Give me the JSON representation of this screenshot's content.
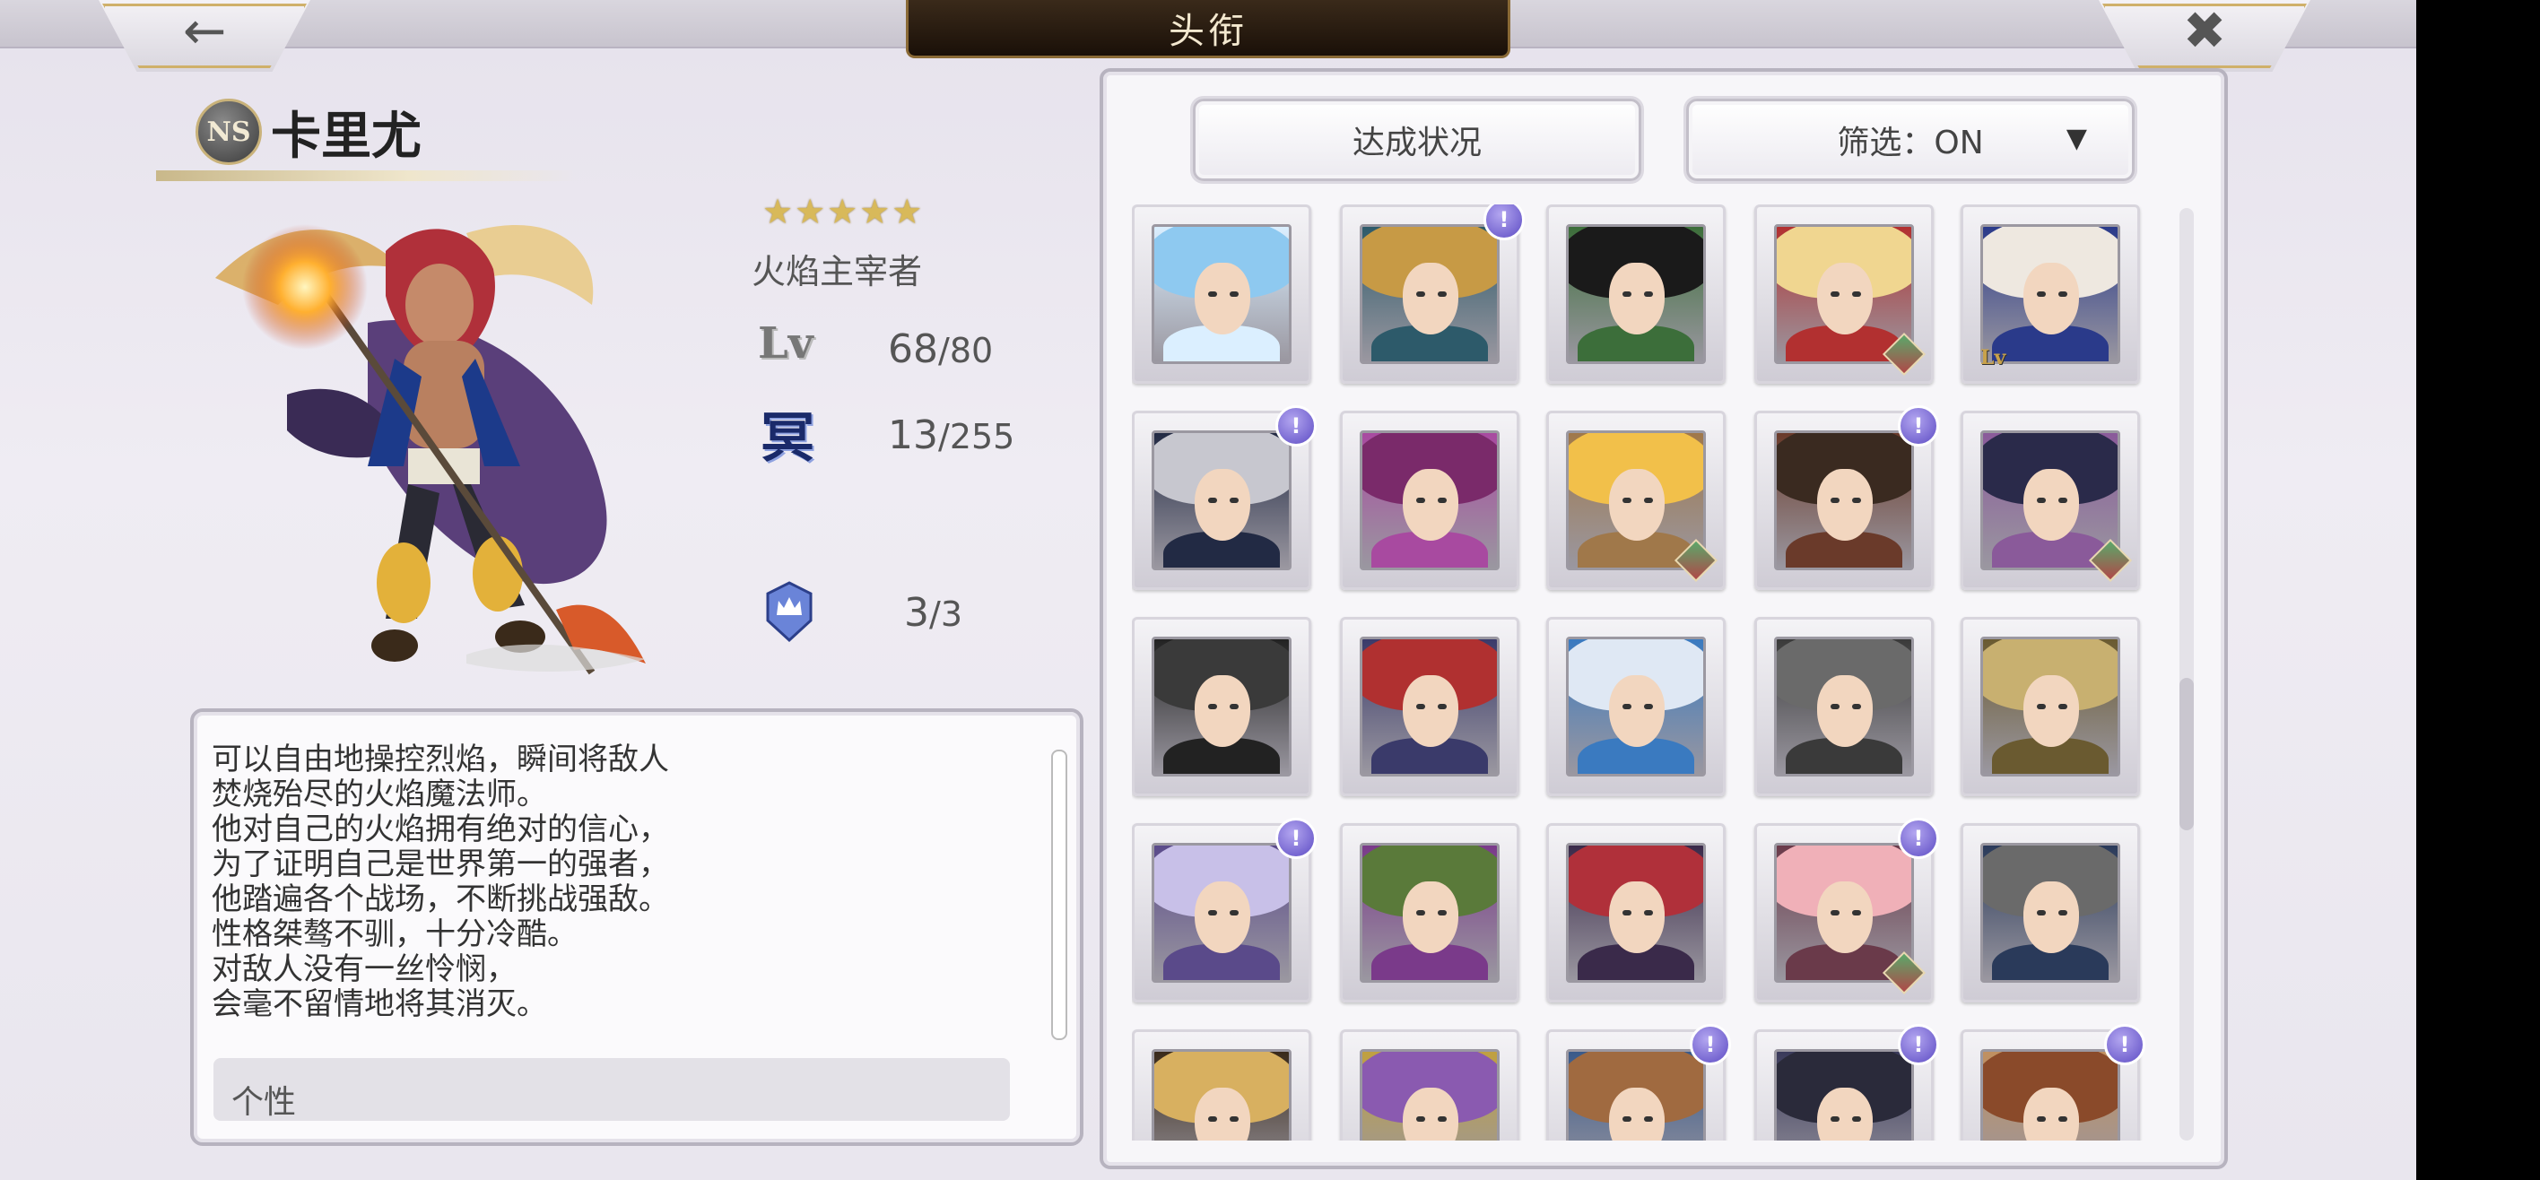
{
  "header": {
    "title": "头衔",
    "back_icon": "arrow-left-icon",
    "close_icon": "close-icon"
  },
  "character": {
    "badge": "NS",
    "name": "卡里尤",
    "stars": "★★★★★",
    "title": "火焰主宰者",
    "lv_label": "Lv",
    "level_current": "68",
    "level_max": "80",
    "ming_label": "冥",
    "ming_current": "13",
    "ming_max": "255",
    "crown_current": "3",
    "crown_max": "3"
  },
  "description": {
    "text": "可以自由地操控烈焰，瞬间将敌人\n焚烧殆尽的火焰魔法师。\n他对自己的火焰拥有绝对的信心，\n为了证明自己是世界第一的强者，\n他踏遍各个战场，不断挑战强敌。\n性格桀骜不驯，十分冷酷。\n对敌人没有一丝怜悯，\n会毫不留情地将其消灭。",
    "trait_label": "个性"
  },
  "controls": {
    "status_label": "达成状况",
    "filter_label": "筛选：ON",
    "filter_arrow": "▼"
  },
  "badge_text": "!",
  "lv_badge_text": "Lv",
  "accent_colors": {
    "gold": "#cfb06a",
    "badge": "#5d4cc4"
  }
}
